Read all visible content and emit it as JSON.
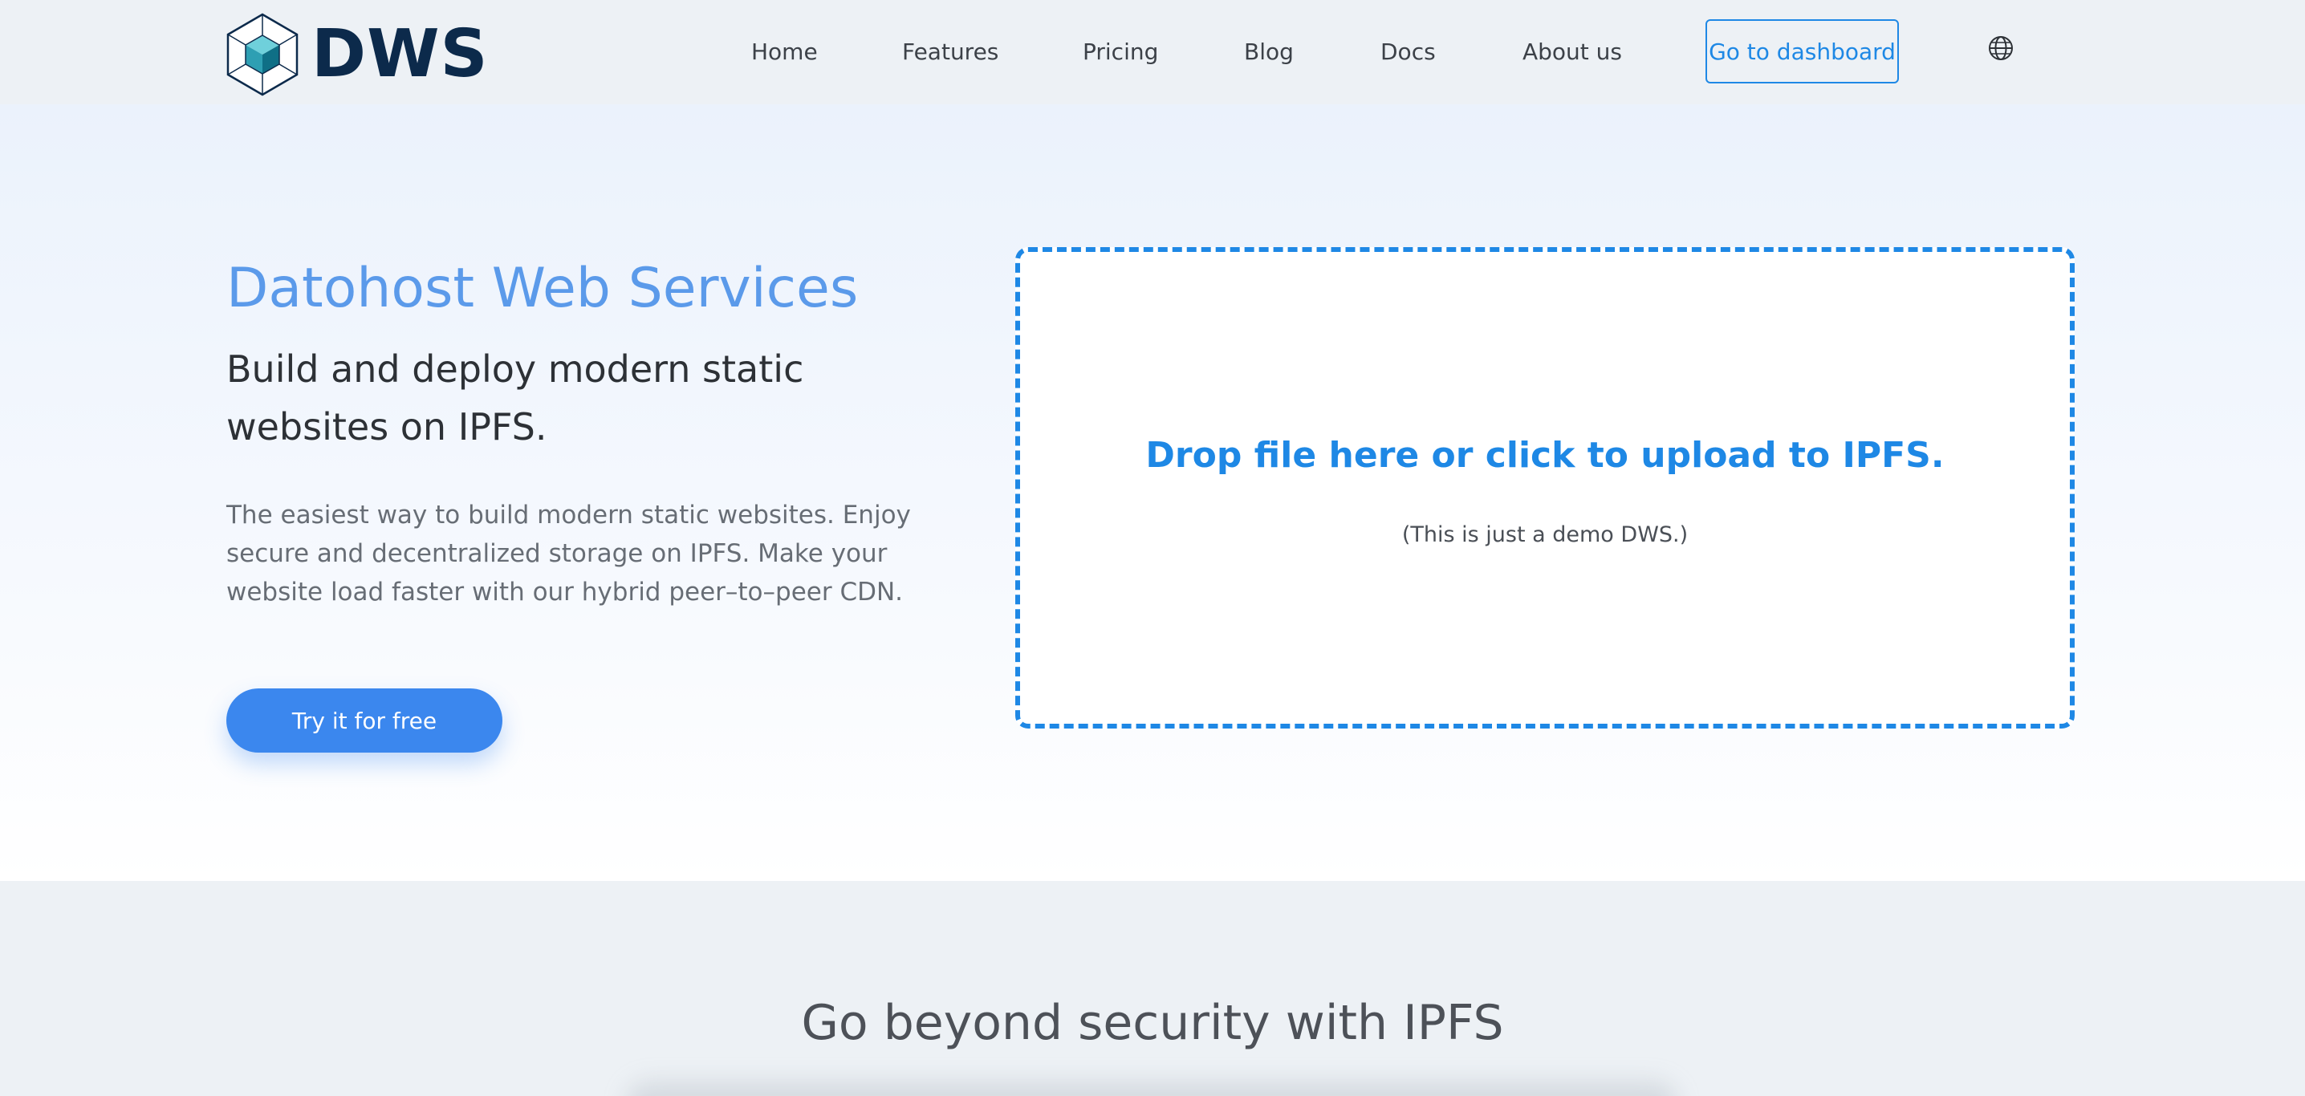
{
  "brand": {
    "name": "DWS",
    "logo_icon": "cube-logo-icon"
  },
  "nav": {
    "links": [
      "Home",
      "Features",
      "Pricing",
      "Blog",
      "Docs",
      "About us"
    ],
    "dashboard_label": "Go to dashboard",
    "language_icon": "globe-icon"
  },
  "hero": {
    "title": "Datohost Web Services",
    "subtitle": "Build and deploy modern static websites on IPFS.",
    "description": "The easiest way to build modern static websites. Enjoy secure and decentralized storage on IPFS. Make your website load faster with our hybrid peer–to–peer CDN.",
    "cta_label": "Try it for free"
  },
  "upload": {
    "title": "Drop file here or click to upload to IPFS.",
    "note": "(This is just a demo DWS.)"
  },
  "section2": {
    "title": "Go beyond security with IPFS"
  },
  "colors": {
    "accent": "#1e88e5",
    "cta": "#3b87ee",
    "hero_title": "#5b9aea",
    "brand_dark": "#0c2a4b",
    "nav_bg": "#edf1f5"
  }
}
